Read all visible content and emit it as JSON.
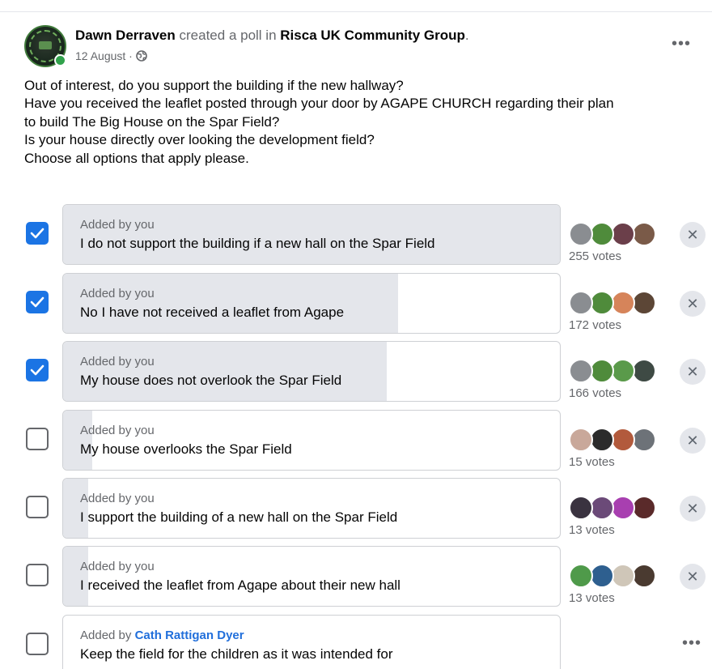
{
  "post": {
    "author": "Dawn Derraven",
    "action_text": "created a poll in",
    "group": "Risca UK Community Group",
    "period": ".",
    "date": "12 August ·",
    "privacy_icon": "globe-icon",
    "menu_label": "•••",
    "body": [
      "Out of interest, do you support the building if the new hallway?",
      "Have you received the leaflet posted through your door by AGAPE CHURCH regarding their plan",
      "to build The Big House on the Spar Field?",
      "Is your house directly over looking the development field?",
      "Choose all options that apply please."
    ]
  },
  "poll": {
    "options": [
      {
        "checked": true,
        "added_prefix": "Added by you",
        "added_by": "",
        "label": "I do not support the building if a new hall on the Spar Field",
        "votes": "255 votes",
        "share": 1.0,
        "remove_label": "✕",
        "voter_colors": [
          "#8a8d91",
          "#4f8b3b",
          "#6b3f4a",
          "#7a5a48"
        ]
      },
      {
        "checked": true,
        "added_prefix": "Added by you",
        "added_by": "",
        "label": "No I have not received a leaflet from Agape",
        "votes": "172 votes",
        "share": 0.675,
        "remove_label": "✕",
        "voter_colors": [
          "#8a8d91",
          "#4f8b3b",
          "#d6845a",
          "#5c4636"
        ]
      },
      {
        "checked": true,
        "added_prefix": "Added by you",
        "added_by": "",
        "label": "My house does not overlook the Spar Field",
        "votes": "166 votes",
        "share": 0.651,
        "remove_label": "✕",
        "voter_colors": [
          "#8a8d91",
          "#4f8b3b",
          "#5a9a4a",
          "#3e4a44"
        ]
      },
      {
        "checked": false,
        "added_prefix": "Added by you",
        "added_by": "",
        "label": "My house overlooks the Spar Field",
        "votes": "15 votes",
        "share": 0.059,
        "remove_label": "✕",
        "voter_colors": [
          "#c9a89a",
          "#2b2b2b",
          "#b25a3c",
          "#6d7278"
        ]
      },
      {
        "checked": false,
        "added_prefix": "Added by you",
        "added_by": "",
        "label": "I support the building of a new hall on the Spar Field",
        "votes": "13 votes",
        "share": 0.051,
        "remove_label": "✕",
        "voter_colors": [
          "#3a3340",
          "#6b4a78",
          "#a83fb0",
          "#5a2a2a"
        ]
      },
      {
        "checked": false,
        "added_prefix": "Added by you",
        "added_by": "",
        "label": "I received the leaflet from Agape about their new hall",
        "votes": "13 votes",
        "share": 0.051,
        "remove_label": "✕",
        "voter_colors": [
          "#4f9a4a",
          "#2e5f8f",
          "#cfc6b8",
          "#4a3a30"
        ]
      },
      {
        "checked": false,
        "added_prefix": "Added by ",
        "added_by": "Cath Rattigan Dyer",
        "label": "Keep the field for the children as it was intended for",
        "votes": "",
        "share": 0,
        "remove_label": "",
        "more_label": "•••",
        "voter_colors": []
      }
    ]
  }
}
